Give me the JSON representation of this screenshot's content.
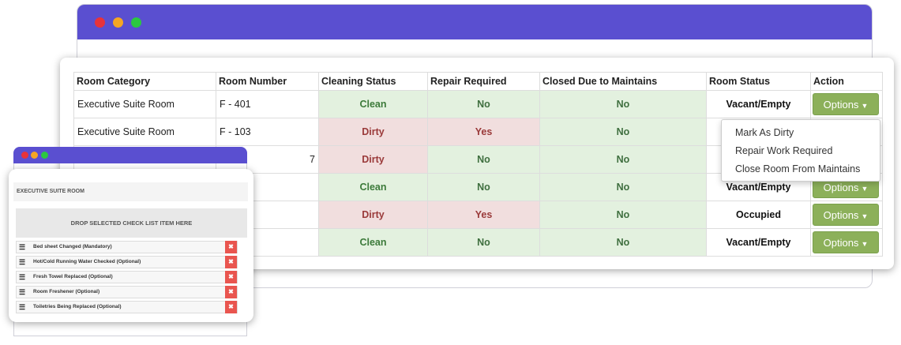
{
  "window_controls": {
    "close_color": "#e8333a",
    "minimize_color": "#f5a623",
    "maximize_color": "#2bc840"
  },
  "accent_bar_color": "#5a4fd0",
  "table": {
    "headers": [
      "Room Category",
      "Room Number",
      "Cleaning Status",
      "Repair Required",
      "Closed Due to Maintains",
      "Room Status",
      "Action"
    ],
    "rows": [
      {
        "category": "Executive Suite Room",
        "number": "F - 401",
        "cleaning": "Clean",
        "repair": "No",
        "closed": "No",
        "status": "Vacant/Empty",
        "action": "Options"
      },
      {
        "category": "Executive Suite Room",
        "number": "F - 103",
        "cleaning": "Dirty",
        "repair": "Yes",
        "closed": "No",
        "status": "",
        "action": ""
      },
      {
        "category": "",
        "number": "7",
        "cleaning": "Dirty",
        "repair": "No",
        "closed": "No",
        "status": "",
        "action": ""
      },
      {
        "category": "",
        "number": "",
        "cleaning": "Clean",
        "repair": "No",
        "closed": "No",
        "status": "Vacant/Empty",
        "action": "Options"
      },
      {
        "category": "",
        "number": "",
        "cleaning": "Dirty",
        "repair": "Yes",
        "closed": "No",
        "status": "Occupied",
        "action": "Options"
      },
      {
        "category": "",
        "number": "",
        "cleaning": "Clean",
        "repair": "No",
        "closed": "No",
        "status": "Vacant/Empty",
        "action": "Options"
      }
    ]
  },
  "options_menu": {
    "items": [
      "Mark As Dirty",
      "Repair Work Required",
      "Close Room From Maintains"
    ]
  },
  "checklist": {
    "title": "EXECUTIVE SUITE ROOM",
    "drop_zone": "DROP SELECTED CHECK LIST ITEM HERE",
    "items": [
      "Bed sheet Changed (Mandatory)",
      "Hot/Cold Running Water Checked (Optional)",
      "Fresh Towel Replaced (Optional)",
      "Room Freshener (Optional)",
      "Toiletries Being Replaced (Optional)"
    ],
    "delete_glyph": "✖"
  }
}
